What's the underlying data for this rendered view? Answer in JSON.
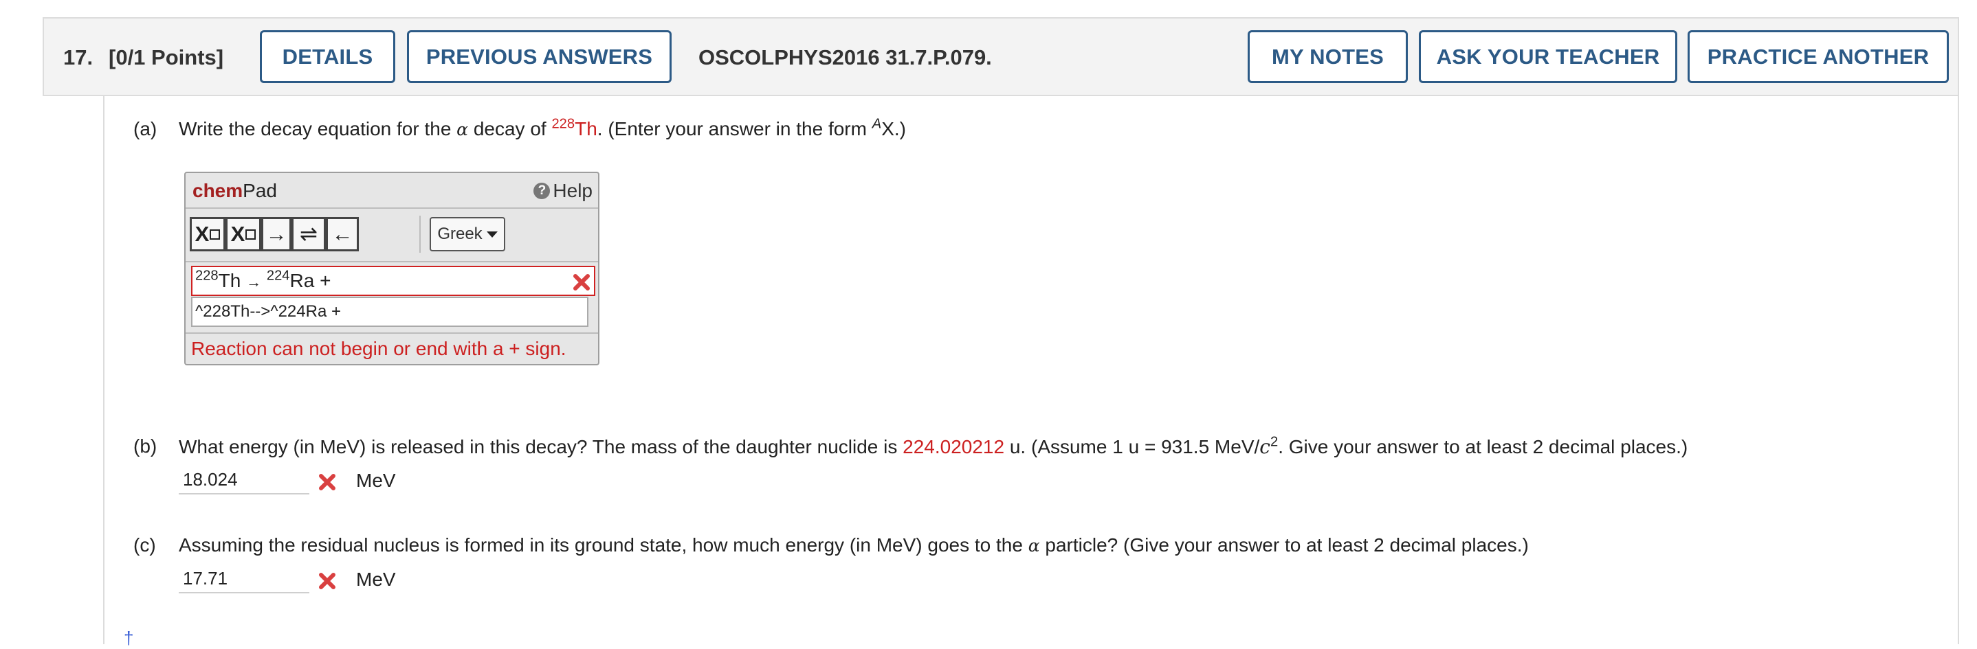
{
  "header": {
    "question_number": "17.",
    "points": "[0/1 Points]",
    "buttons": {
      "details": "DETAILS",
      "previous_answers": "PREVIOUS ANSWERS",
      "my_notes": "MY NOTES",
      "ask_teacher": "ASK YOUR TEACHER",
      "practice_another": "PRACTICE ANOTHER"
    },
    "question_code": "OSCOLPHYS2016 31.7.P.079."
  },
  "part_a": {
    "label": "(a)",
    "text_1": "Write the decay equation for the ",
    "alpha": "α",
    "text_2": " decay of ",
    "nuclide_mass": "228",
    "nuclide_symbol": "Th",
    "text_3": ". (Enter your answer in the form ",
    "form_sup": "A",
    "form_symbol": "X.)"
  },
  "chempad": {
    "title_bold": "chem",
    "title_rest": "Pad",
    "help": "Help",
    "help_icon": "question-circle-icon",
    "tools": {
      "subscript": "X",
      "superscript": "X",
      "right_arrow": "→",
      "equilibrium_arrow": "⇌",
      "left_arrow": "←"
    },
    "greek_label": "Greek",
    "rendered": {
      "mass1": "228",
      "sym1": "Th",
      "arrow": "→",
      "mass2": "224",
      "sym2": "Ra +"
    },
    "raw_input": "^228Th-->^224Ra +",
    "error": "Reaction can not begin or end with a + sign."
  },
  "part_b": {
    "label": "(b)",
    "text_1": "What energy (in MeV) is released in this decay? The mass of the daughter nuclide is ",
    "mass_value": "224.020212",
    "text_2": " u. (Assume 1 u = 931.5 MeV/",
    "c": "c",
    "c_exp": "2",
    "text_3": ". Give your answer to at least 2 decimal places.)",
    "answer": "18.024",
    "unit": "MeV"
  },
  "part_c": {
    "label": "(c)",
    "text_1": "Assuming the residual nucleus is formed in its ground state, how much energy (in MeV) goes to the ",
    "alpha": "α",
    "text_2": " particle? (Give your answer to at least 2 decimal places.)",
    "answer": "17.71",
    "unit": "MeV"
  },
  "footer": {
    "dagger": "†"
  },
  "colors": {
    "button_blue": "#2c5a86",
    "error_red": "#cc2020",
    "header_bg": "#f3f3f3"
  }
}
